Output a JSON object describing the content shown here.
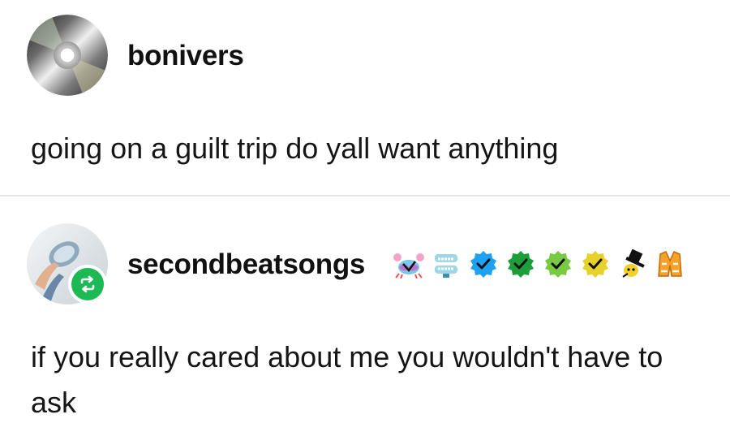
{
  "posts": [
    {
      "username": "bonivers",
      "avatar_icon": "cd-disc-icon",
      "text": "going on a guilt trip do yall want anything"
    },
    {
      "username": "secondbeatsongs",
      "avatar_icon": "profile-photo-icon",
      "reblog_icon": "reblog-icon",
      "badges": [
        "crab-icon",
        "chattering-teeth-icon",
        "blue-checkmark-icon",
        "green-checkmark-icon",
        "lime-checkmark-icon",
        "yellow-checkmark-icon",
        "top-hat-icon",
        "vest-icon"
      ],
      "text": "if you really cared about me you wouldn't have to ask"
    }
  ],
  "colors": {
    "reblog_green": "#1db954",
    "blue_check": "#1da1f2",
    "green_check": "#1e9e3a",
    "lime_check": "#7ac943",
    "yellow_check": "#e6d22b",
    "divider": "#e6e6e6"
  }
}
